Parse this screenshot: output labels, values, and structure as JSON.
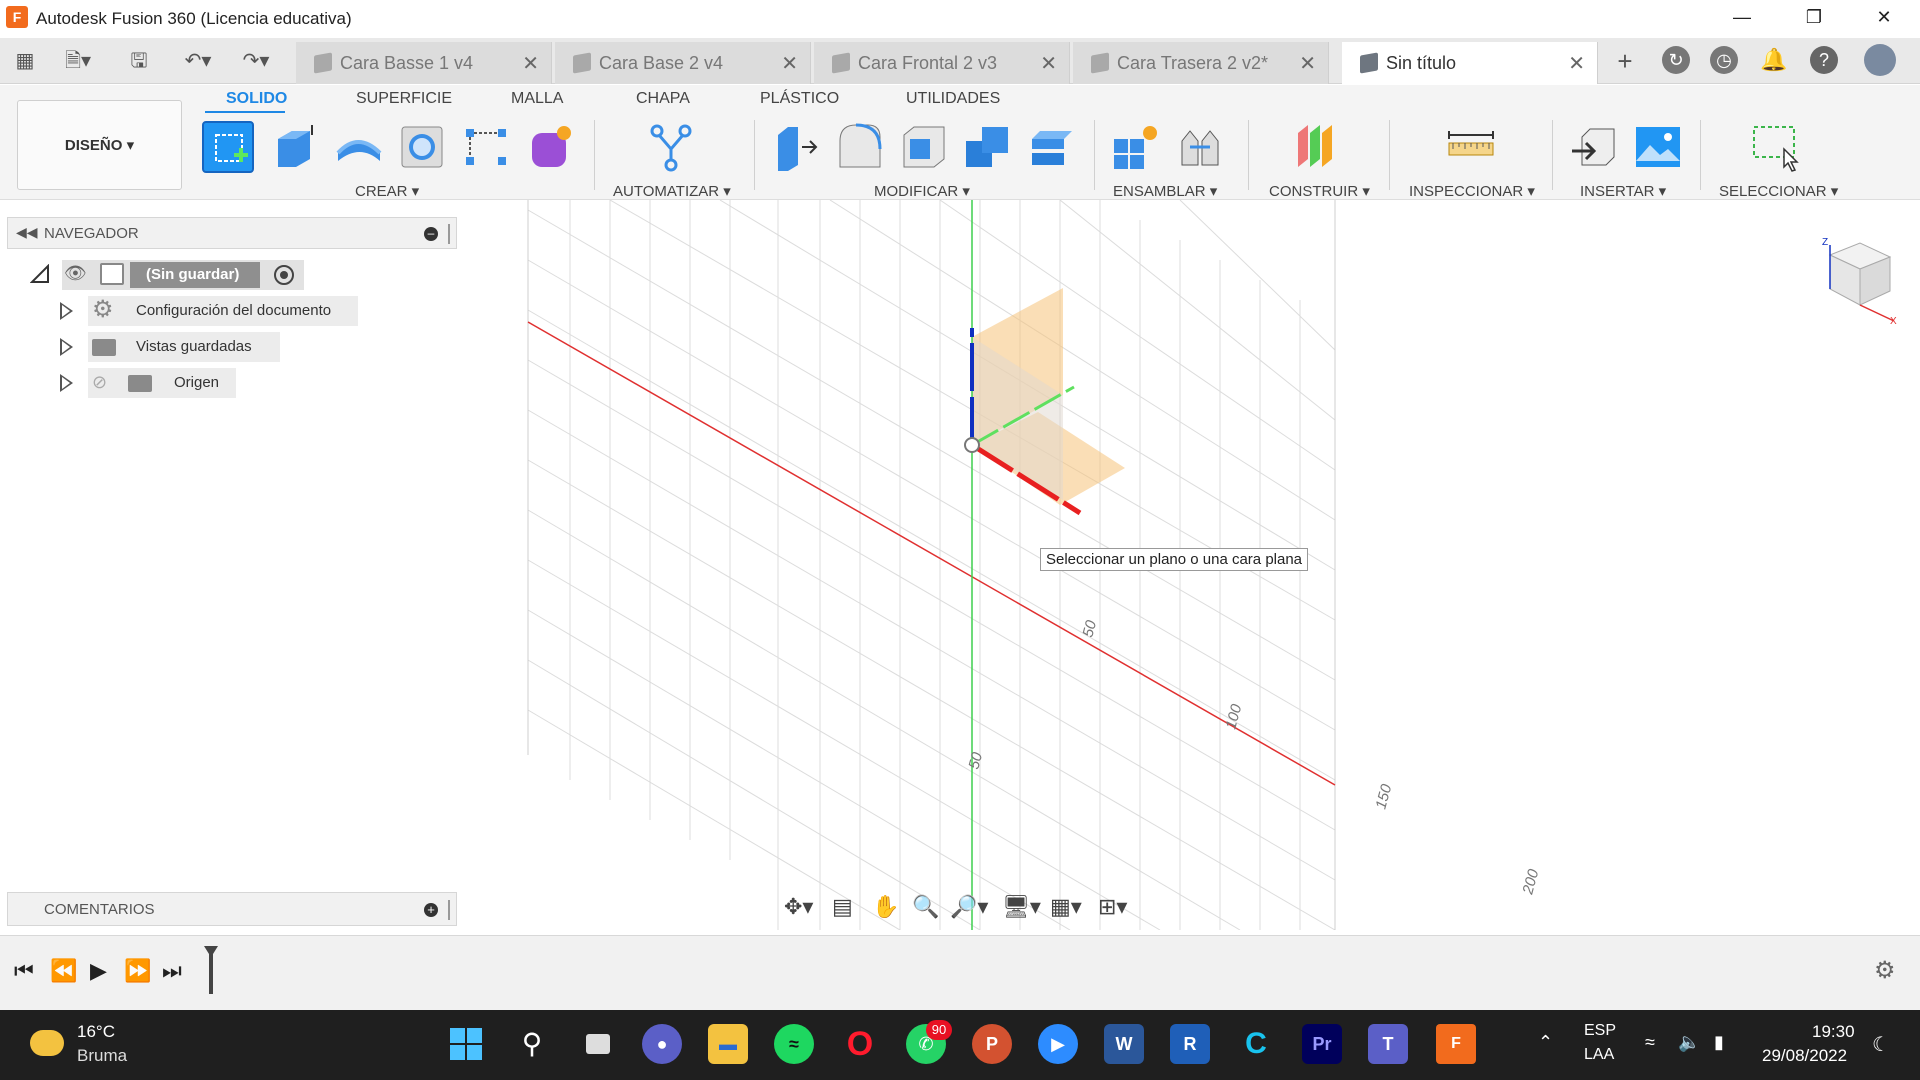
{
  "window": {
    "title": "Autodesk Fusion 360 (Licencia educativa)",
    "app_icon_letter": "F"
  },
  "tabs": [
    {
      "label": "Cara Basse 1 v4",
      "active": false
    },
    {
      "label": "Cara Base 2 v4",
      "active": false
    },
    {
      "label": "Cara Frontal 2 v3",
      "active": false
    },
    {
      "label": "Cara Trasera 2 v2*",
      "active": false
    },
    {
      "label": "Sin título",
      "active": true
    }
  ],
  "ribbon": {
    "workspace": "DISEÑO",
    "menu_tabs": [
      "SOLIDO",
      "SUPERFICIE",
      "MALLA",
      "CHAPA",
      "PLÁSTICO",
      "UTILIDADES"
    ],
    "groups": [
      "CREAR",
      "AUTOMATIZAR",
      "MODIFICAR",
      "ENSAMBLAR",
      "CONSTRUIR",
      "INSPECCIONAR",
      "INSERTAR",
      "SELECCIONAR"
    ]
  },
  "navigator": {
    "title": "NAVEGADOR",
    "root": "(Sin guardar)",
    "items": [
      "Configuración del documento",
      "Vistas guardadas",
      "Origen"
    ]
  },
  "comments": {
    "title": "COMENTARIOS"
  },
  "viewport": {
    "tooltip": "Seleccionar un plano o una cara plana",
    "axis_labels": [
      "50",
      "100",
      "150",
      "200",
      "50"
    ],
    "viewcube_labels": [
      "Z",
      "X"
    ]
  },
  "taskbar": {
    "weather_temp": "16°C",
    "weather_desc": "Bruma",
    "whatsapp_badge": "90",
    "lang": "ESP",
    "layout": "LAA",
    "time": "19:30",
    "date": "29/08/2022"
  },
  "colors": {
    "accent": "#1e88e5",
    "fusion_orange": "#f26b1d",
    "x_axis": "#e03030",
    "y_axis": "#2fbf3f",
    "z_axis": "#1030c0",
    "plane": "#f6c27a"
  }
}
